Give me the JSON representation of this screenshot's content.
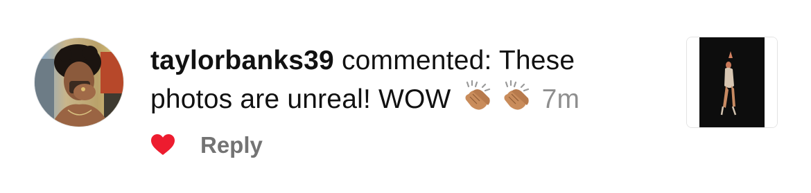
{
  "notification": {
    "username": "taylorbanks39",
    "action": " commented: These photos are unreal! WOW",
    "emoji": [
      "clapping-hands",
      "clapping-hands"
    ],
    "timestamp": "7m"
  },
  "actions": {
    "reply_label": "Reply",
    "liked": true,
    "heart_color": "#ed1c2f"
  },
  "icons": {
    "avatar": "user-avatar",
    "thumbnail": "post-thumbnail",
    "like": "heart-icon"
  }
}
